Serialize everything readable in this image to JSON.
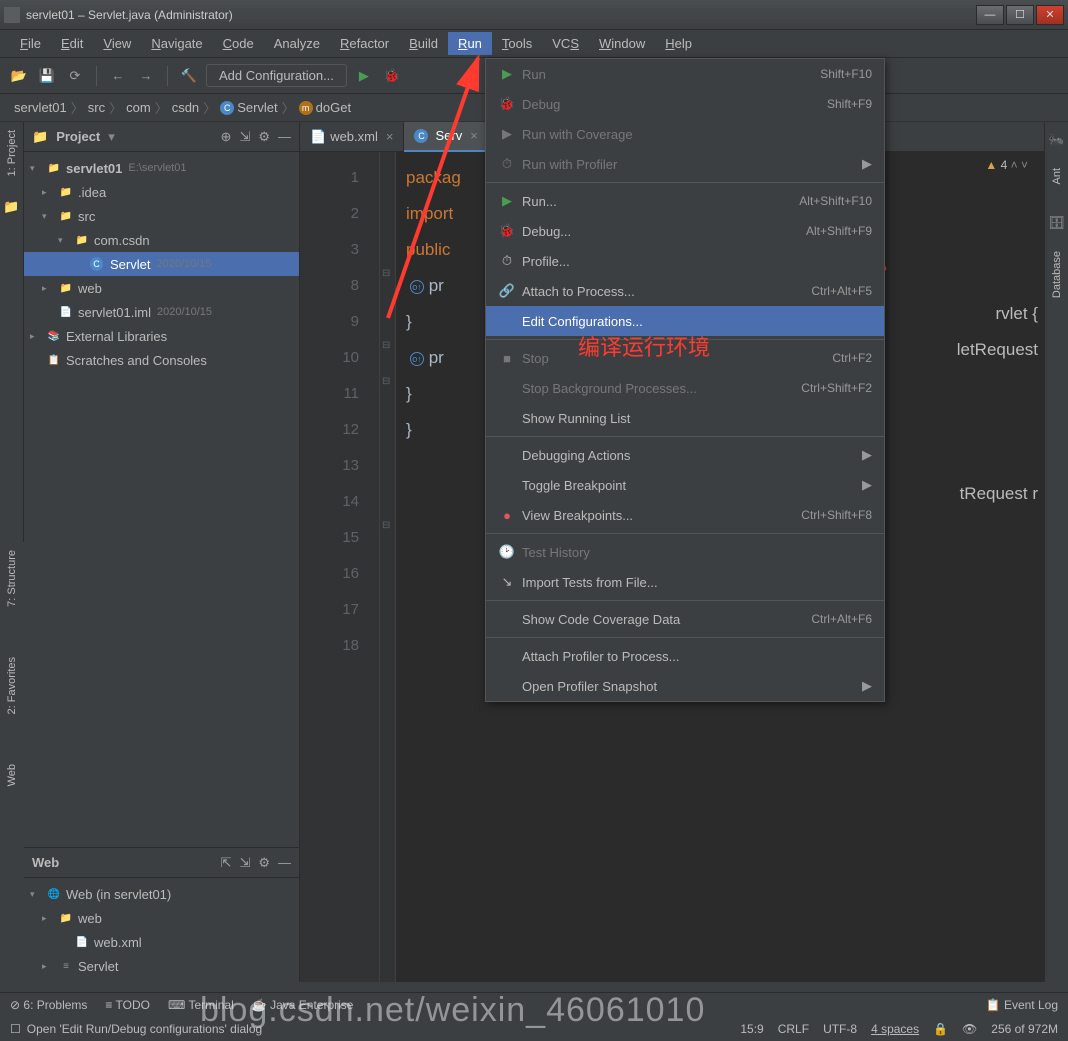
{
  "titlebar": {
    "text": "servlet01 – Servlet.java (Administrator)"
  },
  "menubar": [
    "File",
    "Edit",
    "View",
    "Navigate",
    "Code",
    "Analyze",
    "Refactor",
    "Build",
    "Run",
    "Tools",
    "VCS",
    "Window",
    "Help"
  ],
  "menubar_underline": [
    "F",
    "E",
    "V",
    "N",
    "C",
    "",
    "R",
    "B",
    "R",
    "T",
    "S",
    "W",
    "H"
  ],
  "toolbar": {
    "config": "Add Configuration..."
  },
  "breadcrumbs": [
    {
      "label": "servlet01",
      "badge": ""
    },
    {
      "label": "src",
      "badge": ""
    },
    {
      "label": "com",
      "badge": ""
    },
    {
      "label": "csdn",
      "badge": ""
    },
    {
      "label": "Servlet",
      "badge": "C"
    },
    {
      "label": "doGet",
      "badge": "m"
    }
  ],
  "project_panel": {
    "title": "Project",
    "tree": [
      {
        "ind": 0,
        "arrow": "▾",
        "icon": "📁",
        "label": "servlet01",
        "meta": "E:\\servlet01",
        "bold": true
      },
      {
        "ind": 1,
        "arrow": "▸",
        "icon": "📁",
        "label": ".idea",
        "meta": ""
      },
      {
        "ind": 1,
        "arrow": "▾",
        "icon": "📁",
        "label": "src",
        "meta": ""
      },
      {
        "ind": 2,
        "arrow": "▾",
        "icon": "📁",
        "label": "com.csdn",
        "meta": ""
      },
      {
        "ind": 3,
        "arrow": "",
        "icon": "C",
        "label": "Servlet",
        "meta": "2020/10/15",
        "selected": true
      },
      {
        "ind": 1,
        "arrow": "▸",
        "icon": "📁",
        "label": "web",
        "meta": ""
      },
      {
        "ind": 1,
        "arrow": "",
        "icon": "📄",
        "label": "servlet01.iml",
        "meta": "2020/10/15"
      },
      {
        "ind": 0,
        "arrow": "▸",
        "icon": "📚",
        "label": "External Libraries",
        "meta": ""
      },
      {
        "ind": 0,
        "arrow": "",
        "icon": "📋",
        "label": "Scratches and Consoles",
        "meta": ""
      }
    ]
  },
  "web_panel": {
    "title": "Web",
    "tree": [
      {
        "ind": 0,
        "arrow": "▾",
        "icon": "🌐",
        "label": "Web (in servlet01)"
      },
      {
        "ind": 1,
        "arrow": "▸",
        "icon": "📁",
        "label": "web"
      },
      {
        "ind": 2,
        "arrow": "",
        "icon": "📄",
        "label": "web.xml"
      },
      {
        "ind": 1,
        "arrow": "▸",
        "icon": "≡",
        "label": "Servlet"
      }
    ]
  },
  "tabs": [
    {
      "label": "web.xml",
      "active": false,
      "icon": "📄"
    },
    {
      "label": "Serv",
      "active": true,
      "icon": "C"
    }
  ],
  "editor": {
    "warn_count": "4",
    "lines": [
      "1",
      "2",
      "3",
      "8",
      "9",
      "10",
      "11",
      "12",
      "13",
      "14",
      "15",
      "16",
      "17",
      "18"
    ],
    "code": [
      {
        "t": "packag",
        "cls": "kw"
      },
      {
        "t": "",
        "cls": ""
      },
      {
        "t": "import",
        "cls": "kw"
      },
      {
        "t": "",
        "cls": ""
      },
      {
        "t": "public",
        "cls": "kw",
        "tail": "rvlet {"
      },
      {
        "t": "    pr",
        "cls": "",
        "tail": "letRequest"
      },
      {
        "t": "",
        "cls": ""
      },
      {
        "t": "    }",
        "cls": ""
      },
      {
        "t": "",
        "cls": ""
      },
      {
        "t": "    pr",
        "cls": "",
        "tail": "tRequest r"
      },
      {
        "t": "",
        "cls": ""
      },
      {
        "t": "    }",
        "cls": ""
      },
      {
        "t": "}",
        "cls": ""
      },
      {
        "t": "",
        "cls": ""
      }
    ]
  },
  "run_menu": [
    {
      "label": "Run",
      "shortcut": "Shift+F10",
      "icon": "▶",
      "iconColor": "#499c54",
      "disabled": true
    },
    {
      "label": "Debug",
      "shortcut": "Shift+F9",
      "icon": "🐞",
      "iconColor": "#499c54",
      "disabled": true
    },
    {
      "label": "Run with Coverage",
      "shortcut": "",
      "icon": "▶",
      "disabled": true
    },
    {
      "label": "Run with Profiler",
      "shortcut": "",
      "icon": "⏱",
      "arrow": true,
      "disabled": true
    },
    {
      "sep": true
    },
    {
      "label": "Run...",
      "shortcut": "Alt+Shift+F10",
      "icon": "▶",
      "iconColor": "#499c54"
    },
    {
      "label": "Debug...",
      "shortcut": "Alt+Shift+F9",
      "icon": "🐞",
      "iconColor": "#499c54"
    },
    {
      "label": "Profile...",
      "shortcut": "",
      "icon": "⏱"
    },
    {
      "label": "Attach to Process...",
      "shortcut": "Ctrl+Alt+F5",
      "icon": "🔗"
    },
    {
      "label": "Edit Configurations...",
      "shortcut": "",
      "icon": "",
      "highlight": true
    },
    {
      "sep": true
    },
    {
      "label": "Stop",
      "shortcut": "Ctrl+F2",
      "icon": "■",
      "disabled": true
    },
    {
      "label": "Stop Background Processes...",
      "shortcut": "Ctrl+Shift+F2",
      "disabled": true
    },
    {
      "label": "Show Running List",
      "shortcut": ""
    },
    {
      "sep": true
    },
    {
      "label": "Debugging Actions",
      "shortcut": "",
      "arrow": true
    },
    {
      "label": "Toggle Breakpoint",
      "shortcut": "",
      "arrow": true
    },
    {
      "label": "View Breakpoints...",
      "shortcut": "Ctrl+Shift+F8",
      "icon": "●",
      "iconColor": "#db5860"
    },
    {
      "sep": true
    },
    {
      "label": "Test History",
      "shortcut": "",
      "icon": "🕑",
      "disabled": true
    },
    {
      "label": "Import Tests from File...",
      "shortcut": "",
      "icon": "↘"
    },
    {
      "sep": true
    },
    {
      "label": "Show Code Coverage Data",
      "shortcut": "Ctrl+Alt+F6"
    },
    {
      "sep": true
    },
    {
      "label": "Attach Profiler to Process...",
      "shortcut": ""
    },
    {
      "label": "Open Profiler Snapshot",
      "shortcut": "",
      "arrow": true
    }
  ],
  "annotation": {
    "text": "编译运行环境"
  },
  "left_rail": [
    "1: Project"
  ],
  "left_rail2": [
    "7: Structure",
    "2: Favorites",
    "Web"
  ],
  "right_rail": [
    "Ant",
    "Database"
  ],
  "status_top": [
    "6: Problems",
    "TODO",
    "Terminal",
    "Java Enterprise"
  ],
  "status_top_right": "Event Log",
  "status_bot": "Open 'Edit Run/Debug configurations' dialog",
  "status_right": [
    "15:9",
    "CRLF",
    "UTF-8",
    "4 spaces",
    "256 of 972M"
  ],
  "watermark": "blog.csdn.net/weixin_46061010"
}
